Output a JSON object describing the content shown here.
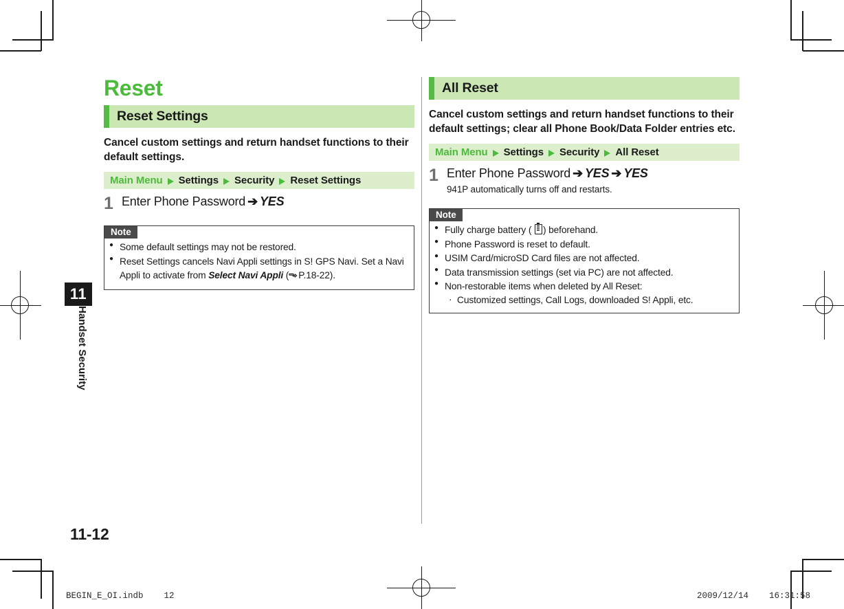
{
  "page": {
    "folio": "11-12",
    "chapter_number": "11",
    "chapter_label": "Handset Security",
    "slug_left": "BEGIN_E_OI.indb    12",
    "slug_right": "2009/12/14    16:31:58"
  },
  "colors": {
    "title_green": "#4cbb3c",
    "header_band": "#cbe8b4",
    "header_accent": "#55bb45",
    "crumb_band": "#ddeecd",
    "note_tab": "#4a4a4a",
    "step_number": "#6e6e6e",
    "body_text": "#1a1a1a"
  },
  "left_column": {
    "title": "Reset",
    "section": {
      "heading": "Reset Settings",
      "lead": "Cancel custom settings and return handset functions to their default settings.",
      "breadcrumb": {
        "root": "Main Menu",
        "items": [
          "Settings",
          "Security",
          "Reset Settings"
        ]
      },
      "steps": [
        {
          "number": "1",
          "prefix": "Enter Phone Password",
          "arrow": "➔",
          "emphasis": "YES",
          "sub": ""
        }
      ],
      "note": {
        "label": "Note",
        "items": [
          {
            "level": 1,
            "text": "Some default settings may not be restored."
          },
          {
            "level": 1,
            "text_before": "Reset Settings cancels Navi Appli settings in S! GPS Navi. Set a Navi Appli to activate from ",
            "emphasis": "Select Navi Appli",
            "reference": "P.18-22",
            "text_after": "."
          }
        ]
      }
    }
  },
  "right_column": {
    "section": {
      "heading": "All Reset",
      "lead": "Cancel custom settings and return handset functions to their default settings; clear all Phone Book/Data Folder entries etc.",
      "breadcrumb": {
        "root": "Main Menu",
        "items": [
          "Settings",
          "Security",
          "All Reset"
        ]
      },
      "steps": [
        {
          "number": "1",
          "prefix": "Enter Phone Password",
          "arrow": "➔",
          "emphasis": "YES",
          "arrow2": "➔",
          "emphasis2": "YES",
          "sub": "941P automatically turns off and restarts."
        }
      ],
      "note": {
        "label": "Note",
        "items": [
          {
            "level": 1,
            "text_before": "Fully charge battery ( ",
            "icon": "battery-icon",
            "text_after": ") beforehand."
          },
          {
            "level": 1,
            "text": "Phone Password is reset to default."
          },
          {
            "level": 1,
            "text": "USIM Card/microSD Card files are not affected."
          },
          {
            "level": 1,
            "text": "Data transmission settings (set via PC) are not affected."
          },
          {
            "level": 1,
            "text": "Non-restorable items when deleted by All Reset:"
          },
          {
            "level": 2,
            "text": "Customized settings, Call Logs, downloaded S! Appli, etc."
          }
        ]
      }
    }
  }
}
